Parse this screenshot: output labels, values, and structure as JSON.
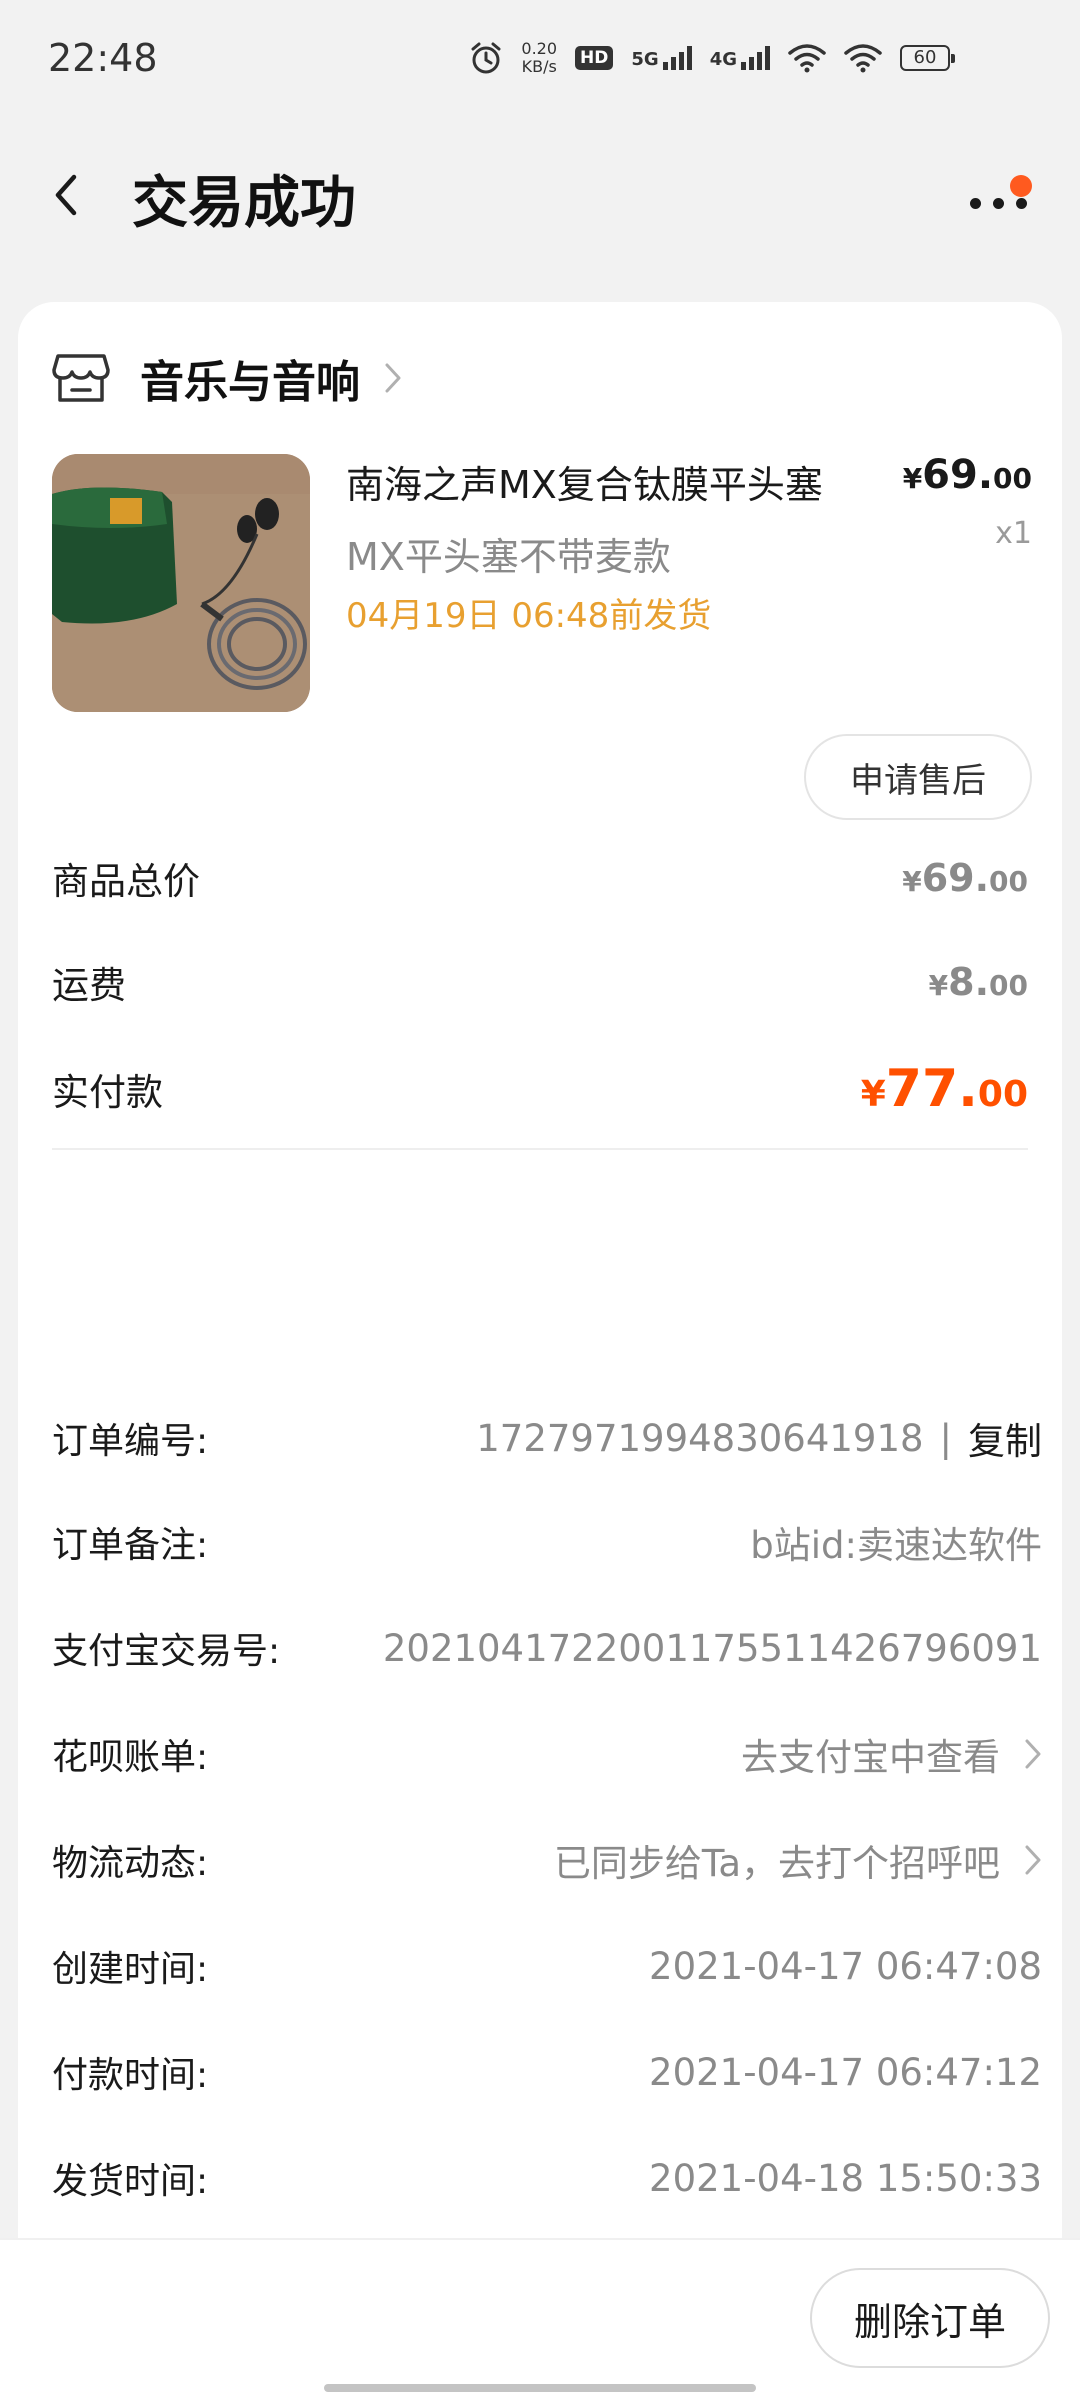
{
  "status_bar": {
    "time": "22:48",
    "speed_value": "0.20",
    "speed_unit": "KB/s",
    "hd_label": "HD",
    "net_5g": "5G",
    "net_4g": "4G",
    "battery": "60",
    "icons": [
      "alarm-icon",
      "hd-icon",
      "signal-icon",
      "wifi-icon",
      "battery-icon"
    ]
  },
  "header": {
    "title": "交易成功",
    "back_icon": "chevron-left-icon",
    "more_icon": "more-dots-icon",
    "has_notification_dot": true
  },
  "shop": {
    "name": "音乐与音响",
    "icon": "store-icon"
  },
  "product": {
    "title": "南海之声MX复合钛膜平头塞",
    "variant": "MX平头塞不带麦款",
    "ship_deadline": "04月19日 06:48前发货",
    "price_symbol": "¥",
    "price_int": "69.",
    "price_dec": "00",
    "quantity": "x1",
    "after_sales_label": "申请售后"
  },
  "fees": {
    "subtotal_label": "商品总价",
    "subtotal_symbol": "¥",
    "subtotal_int": "69.",
    "subtotal_dec": "00",
    "shipping_label": "运费",
    "shipping_symbol": "¥",
    "shipping_int": "8.",
    "shipping_dec": "00",
    "paid_label": "实付款",
    "paid_symbol": "¥",
    "paid_int": "77.",
    "paid_dec": "00",
    "paid_color": "#ff5000"
  },
  "order_info": {
    "order_no_label": "订单编号:",
    "order_no_value": "1727971994830641918",
    "separator": "|",
    "copy_label": "复制",
    "remark_label": "订单备注:",
    "remark_value": "b站id:卖速达软件",
    "alipay_label": "支付宝交易号:",
    "alipay_value": "2021041722001175511426796091",
    "huabei_label": "花呗账单:",
    "huabei_value": "去支付宝中查看",
    "logistics_label": "物流动态:",
    "logistics_value": "已同步给Ta，去打个招呼吧",
    "created_label": "创建时间:",
    "created_value": "2021-04-17 06:47:08",
    "paid_time_label": "付款时间:",
    "paid_time_value": "2021-04-17 06:47:12",
    "shipped_label": "发货时间:",
    "shipped_value": "2021-04-18 15:50:33"
  },
  "bottom_bar": {
    "delete_label": "删除订单"
  }
}
